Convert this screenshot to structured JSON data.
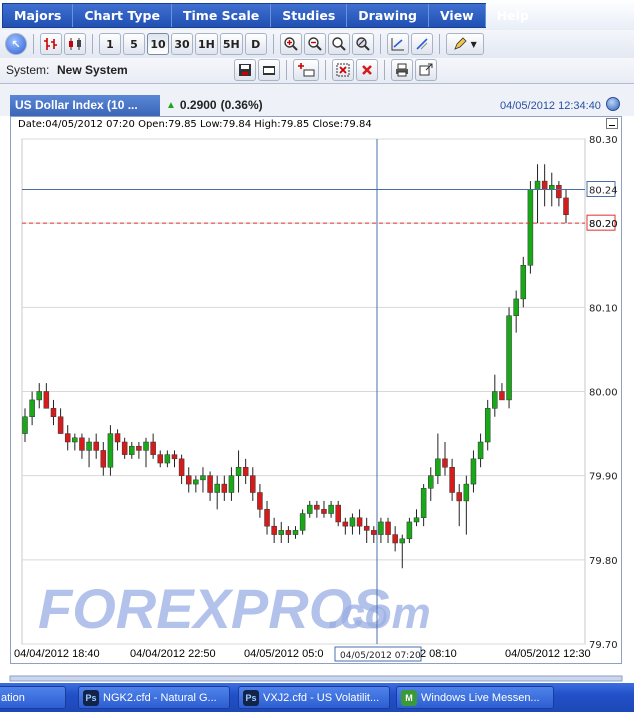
{
  "menu": [
    "Majors",
    "Chart Type",
    "Time Scale",
    "Studies",
    "Drawing",
    "View",
    "Help"
  ],
  "toolbar": {
    "intervals": [
      "1",
      "5",
      "10",
      "30",
      "1H",
      "5H",
      "D"
    ],
    "active_interval": "10"
  },
  "system": {
    "label": "System:",
    "value": "New System"
  },
  "chart_header": {
    "title": "US Dollar Index (10 ...",
    "change": "0.2900",
    "change_pct": "(0.36%)",
    "datetime": "04/05/2012 12:34:40"
  },
  "ohlc_line": "Date:04/05/2012 07:20 Open:79.85 Low:79.84 High:79.85 Close:79.84",
  "watermark": {
    "part1": "FOREXPROS",
    "part2": ".com"
  },
  "crosshair": {
    "time_label": "04/05/2012 07:20",
    "price_label": "80.24"
  },
  "current_price_label": "80.20",
  "colors": {
    "up": "#18a818",
    "down": "#d41c1c",
    "crosshair": "#4a6fa8",
    "price_line": "#e03030",
    "accent": "#2f5bbd"
  },
  "chart_data": {
    "type": "candlestick",
    "y_ticks": [
      "80.30",
      "80.20",
      "80.10",
      "80.00",
      "79.90",
      "79.80",
      "79.70"
    ],
    "ylim": [
      79.7,
      80.3
    ],
    "x_tick_labels": [
      "04/04/2012 18:40",
      "04/04/2012 22:50",
      "04/05/2012 05:0",
      "2 08:10",
      "04/05/2012 12:30"
    ],
    "current_price": 80.2,
    "crosshair_price": 80.24,
    "candles": [
      [
        79.95,
        79.98,
        79.94,
        79.97
      ],
      [
        79.97,
        80.0,
        79.96,
        79.99
      ],
      [
        79.99,
        80.01,
        79.98,
        80.0
      ],
      [
        80.0,
        80.01,
        79.98,
        79.98
      ],
      [
        79.98,
        79.99,
        79.96,
        79.97
      ],
      [
        79.97,
        79.98,
        79.95,
        79.95
      ],
      [
        79.95,
        79.96,
        79.93,
        79.94
      ],
      [
        79.94,
        79.95,
        79.93,
        79.945
      ],
      [
        79.945,
        79.95,
        79.92,
        79.93
      ],
      [
        79.93,
        79.945,
        79.91,
        79.94
      ],
      [
        79.94,
        79.95,
        79.92,
        79.93
      ],
      [
        79.93,
        79.94,
        79.9,
        79.91
      ],
      [
        79.91,
        79.96,
        79.9,
        79.95
      ],
      [
        79.95,
        79.955,
        79.93,
        79.94
      ],
      [
        79.94,
        79.945,
        79.92,
        79.925
      ],
      [
        79.925,
        79.94,
        79.92,
        79.935
      ],
      [
        79.935,
        79.94,
        79.92,
        79.93
      ],
      [
        79.93,
        79.945,
        79.91,
        79.94
      ],
      [
        79.94,
        79.95,
        79.92,
        79.925
      ],
      [
        79.925,
        79.93,
        79.91,
        79.915
      ],
      [
        79.915,
        79.93,
        79.91,
        79.925
      ],
      [
        79.925,
        79.93,
        79.91,
        79.92
      ],
      [
        79.92,
        79.925,
        79.89,
        79.9
      ],
      [
        79.9,
        79.91,
        79.88,
        79.89
      ],
      [
        79.89,
        79.9,
        79.88,
        79.895
      ],
      [
        79.895,
        79.91,
        79.88,
        79.9
      ],
      [
        79.9,
        79.905,
        79.87,
        79.88
      ],
      [
        79.88,
        79.9,
        79.86,
        79.89
      ],
      [
        79.89,
        79.9,
        79.87,
        79.88
      ],
      [
        79.88,
        79.91,
        79.87,
        79.9
      ],
      [
        79.9,
        79.93,
        79.88,
        79.91
      ],
      [
        79.91,
        79.92,
        79.89,
        79.9
      ],
      [
        79.9,
        79.91,
        79.87,
        79.88
      ],
      [
        79.88,
        79.89,
        79.85,
        79.86
      ],
      [
        79.86,
        79.87,
        79.83,
        79.84
      ],
      [
        79.84,
        79.85,
        79.82,
        79.83
      ],
      [
        79.83,
        79.845,
        79.82,
        79.835
      ],
      [
        79.835,
        79.84,
        79.82,
        79.83
      ],
      [
        79.83,
        79.84,
        79.825,
        79.835
      ],
      [
        79.835,
        79.86,
        79.83,
        79.855
      ],
      [
        79.855,
        79.87,
        79.85,
        79.865
      ],
      [
        79.865,
        79.87,
        79.85,
        79.86
      ],
      [
        79.86,
        79.87,
        79.85,
        79.855
      ],
      [
        79.855,
        79.87,
        79.85,
        79.865
      ],
      [
        79.865,
        79.87,
        79.84,
        79.845
      ],
      [
        79.845,
        79.85,
        79.83,
        79.84
      ],
      [
        79.84,
        79.855,
        79.83,
        79.85
      ],
      [
        79.85,
        79.86,
        79.83,
        79.84
      ],
      [
        79.84,
        79.85,
        79.82,
        79.835
      ],
      [
        79.835,
        79.84,
        79.82,
        79.83
      ],
      [
        79.83,
        79.85,
        79.82,
        79.845
      ],
      [
        79.845,
        79.85,
        79.82,
        79.83
      ],
      [
        79.83,
        79.84,
        79.81,
        79.82
      ],
      [
        79.82,
        79.83,
        79.79,
        79.825
      ],
      [
        79.825,
        79.85,
        79.82,
        79.845
      ],
      [
        79.845,
        79.86,
        79.84,
        79.85
      ],
      [
        79.85,
        79.89,
        79.84,
        79.885
      ],
      [
        79.885,
        79.91,
        79.87,
        79.9
      ],
      [
        79.9,
        79.95,
        79.89,
        79.92
      ],
      [
        79.92,
        79.94,
        79.9,
        79.91
      ],
      [
        79.91,
        79.92,
        79.87,
        79.88
      ],
      [
        79.88,
        79.89,
        79.84,
        79.87
      ],
      [
        79.87,
        79.9,
        79.83,
        79.89
      ],
      [
        79.89,
        79.93,
        79.88,
        79.92
      ],
      [
        79.92,
        79.95,
        79.91,
        79.94
      ],
      [
        79.94,
        79.99,
        79.93,
        79.98
      ],
      [
        79.98,
        80.02,
        79.97,
        80.0
      ],
      [
        80.0,
        80.01,
        79.99,
        79.99
      ],
      [
        79.99,
        80.1,
        79.98,
        80.09
      ],
      [
        80.09,
        80.12,
        80.07,
        80.11
      ],
      [
        80.11,
        80.16,
        80.1,
        80.15
      ],
      [
        80.15,
        80.25,
        80.14,
        80.24
      ],
      [
        80.24,
        80.27,
        80.2,
        80.25
      ],
      [
        80.25,
        80.27,
        80.22,
        80.24
      ],
      [
        80.24,
        80.26,
        80.22,
        80.245
      ],
      [
        80.245,
        80.25,
        80.22,
        80.23
      ],
      [
        80.23,
        80.24,
        80.2,
        80.21
      ]
    ]
  },
  "taskbar": [
    {
      "label": "ation",
      "icon": ""
    },
    {
      "label": "NGK2.cfd - Natural G...",
      "icon": "Ps"
    },
    {
      "label": "VXJ2.cfd - US Volatilit...",
      "icon": "Ps"
    },
    {
      "label": "Windows Live Messen...",
      "icon": "M"
    }
  ]
}
